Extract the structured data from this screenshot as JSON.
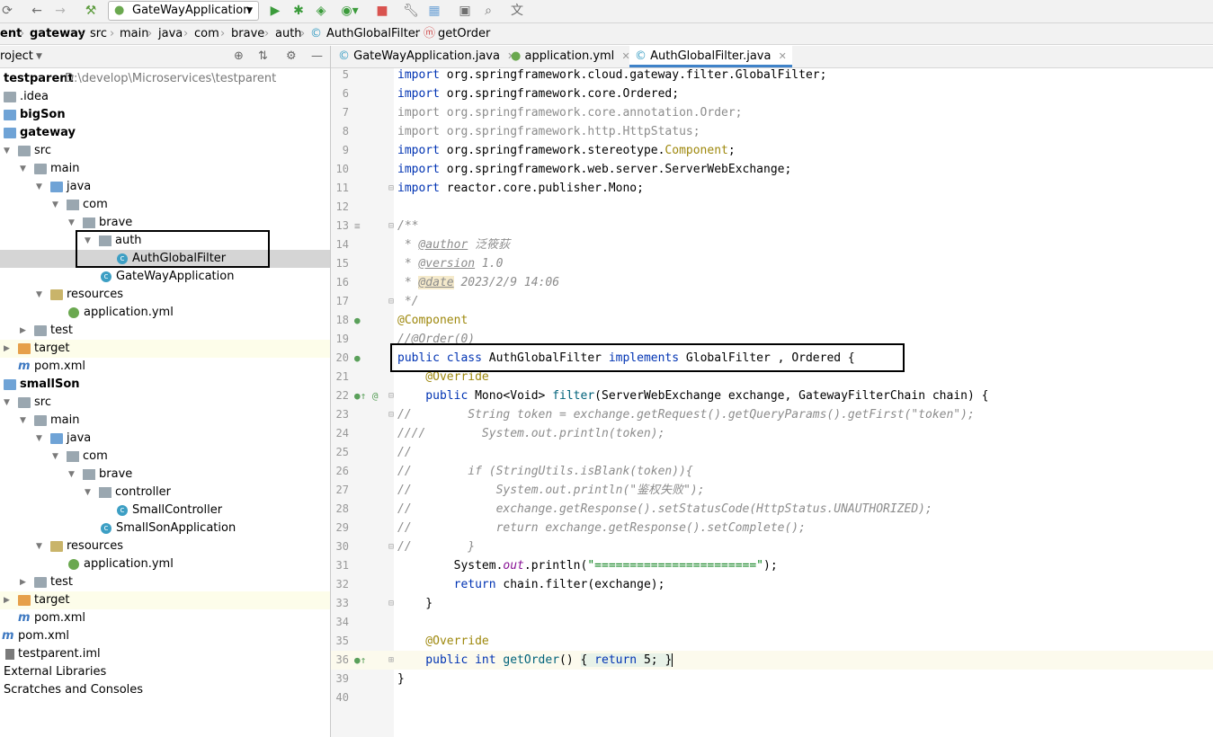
{
  "toolbar": {
    "run_config": "GateWayApplication",
    "icons": [
      "sync-icon",
      "back-icon",
      "forward-icon",
      "build-hammer-icon",
      "run-icon",
      "debug-icon",
      "coverage-icon",
      "profile-icon",
      "stop-icon",
      "settings-wrench-icon",
      "project-structure-icon",
      "layout-icon",
      "search-icon",
      "translate-icon"
    ]
  },
  "breadcrumb": [
    "ent",
    "gateway",
    "src",
    "main",
    "java",
    "com",
    "brave",
    "auth",
    "AuthGlobalFilter",
    "getOrder"
  ],
  "project_panel": {
    "title": "roject",
    "tree": [
      {
        "label": "testparent",
        "path": "D:\\develop\\Microservices\\testparent"
      },
      {
        "label": ".idea"
      },
      {
        "label": "bigSon"
      },
      {
        "label": "gateway"
      },
      {
        "label": "src"
      },
      {
        "label": "main"
      },
      {
        "label": "java"
      },
      {
        "label": "com"
      },
      {
        "label": "brave"
      },
      {
        "label": "auth"
      },
      {
        "label": "AuthGlobalFilter"
      },
      {
        "label": "GateWayApplication"
      },
      {
        "label": "resources"
      },
      {
        "label": "application.yml"
      },
      {
        "label": "test"
      },
      {
        "label": "target"
      },
      {
        "label": "pom.xml"
      },
      {
        "label": "smallSon"
      },
      {
        "label": "src"
      },
      {
        "label": "main"
      },
      {
        "label": "java"
      },
      {
        "label": "com"
      },
      {
        "label": "brave"
      },
      {
        "label": "controller"
      },
      {
        "label": "SmallController"
      },
      {
        "label": "SmallSonApplication"
      },
      {
        "label": "resources"
      },
      {
        "label": "application.yml"
      },
      {
        "label": "test"
      },
      {
        "label": "target"
      },
      {
        "label": "pom.xml"
      },
      {
        "label": "pom.xml"
      },
      {
        "label": "testparent.iml"
      },
      {
        "label": "External Libraries"
      },
      {
        "label": "Scratches and Consoles"
      }
    ]
  },
  "tabs": [
    {
      "label": "GateWayApplication.java"
    },
    {
      "label": "application.yml"
    },
    {
      "label": "AuthGlobalFilter.java"
    }
  ],
  "editor": {
    "line_numbers": [
      "5",
      "6",
      "7",
      "8",
      "9",
      "10",
      "11",
      "12",
      "13",
      "14",
      "15",
      "16",
      "17",
      "18",
      "19",
      "20",
      "21",
      "22",
      "23",
      "24",
      "25",
      "26",
      "27",
      "28",
      "29",
      "30",
      "31",
      "32",
      "33",
      "34",
      "35",
      "36",
      "39",
      "40"
    ],
    "lines": {
      "l5a": "import",
      "l5b": " org.springframework.cloud.gateway.filter.GlobalFilter;",
      "l6a": "import",
      "l6b": " org.springframework.core.Ordered;",
      "l7": "import org.springframework.core.annotation.Order;",
      "l8": "import org.springframework.http.HttpStatus;",
      "l9a": "import",
      "l9b": " org.springframework.stereotype.",
      "l9c": "Component",
      "l9d": ";",
      "l10a": "import",
      "l10b": " org.springframework.web.server.ServerWebExchange;",
      "l11a": "import",
      "l11b": " reactor.core.publisher.Mono;",
      "l13": "/**",
      "l14a": " * ",
      "l14b": "@author",
      "l14c": " 泛筱荻",
      "l15a": " * ",
      "l15b": "@version",
      "l15c": " 1.0",
      "l16a": " * ",
      "l16b": "@date",
      "l16c": " 2023/2/9 14:06",
      "l17": " */",
      "l18": "@Component",
      "l19": "//@Order(0)",
      "l20a": "public class",
      "l20b": " AuthGlobalFilter ",
      "l20c": "implements",
      "l20d": " GlobalFilter , Ordered {",
      "l21": "    @Override",
      "l22a": "    public",
      "l22b": " Mono<Void> ",
      "l22c": "filter",
      "l22d": "(ServerWebExchange exchange, GatewayFilterChain chain) {",
      "l23": "//        String token = exchange.getRequest().getQueryParams().getFirst(\"token\");",
      "l24": "////        System.out.println(token);",
      "l25": "//",
      "l26": "//        if (StringUtils.isBlank(token)){",
      "l27": "//            System.out.println(\"鉴权失败\");",
      "l28": "//            exchange.getResponse().setStatusCode(HttpStatus.UNAUTHORIZED);",
      "l29": "//            return exchange.getResponse().setComplete();",
      "l30": "//        }",
      "l31a": "        System.",
      "l31b": "out",
      "l31c": ".println(",
      "l31d": "\"=======================\"",
      "l31e": ");",
      "l32a": "        return",
      "l32b": " chain.filter(exchange);",
      "l33": "    }",
      "l35": "    @Override",
      "l36a": "    public int",
      "l36b": " getOrder",
      "l36c": "() ",
      "l36d": "{ ",
      "l36e": "return",
      "l36f": " 5; ",
      "l36g": "}",
      "l39": "}"
    }
  }
}
